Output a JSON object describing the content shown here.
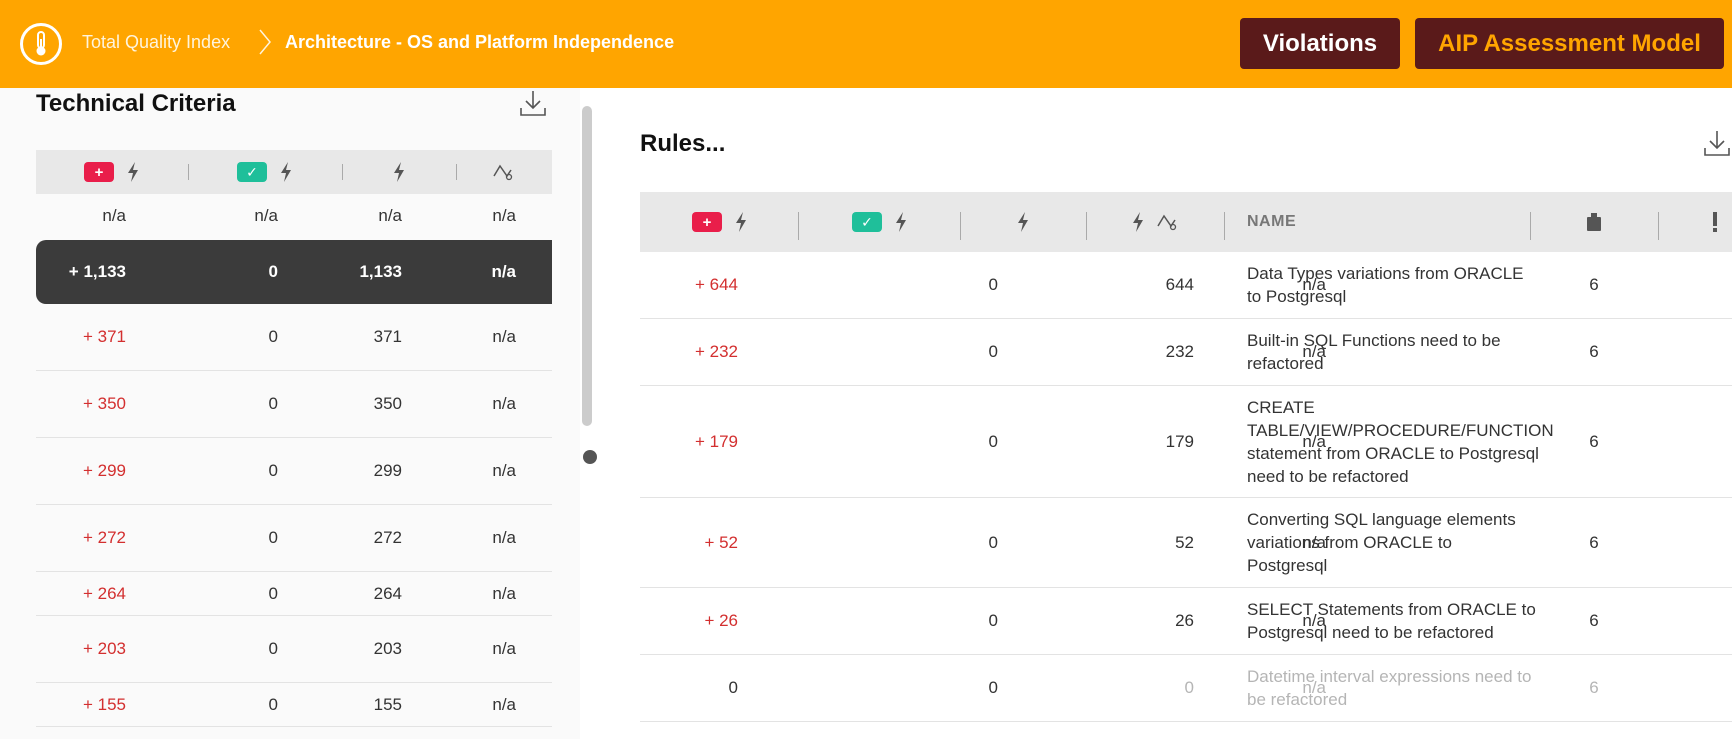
{
  "header": {
    "breadcrumb_root": "Total Quality Index",
    "breadcrumb_current": "Architecture - OS and Platform Independence",
    "violations_label": "Violations",
    "model_label": "AIP Assessment Model"
  },
  "technical_criteria": {
    "title": "Technical Criteria",
    "summary": [
      "n/a",
      "n/a",
      "n/a",
      "n/a"
    ],
    "rows": [
      {
        "added": "+ 1,133",
        "removed": "0",
        "total": "1,133",
        "trend": "n/a",
        "selected": true
      },
      {
        "added": "+ 371",
        "removed": "0",
        "total": "371",
        "trend": "n/a"
      },
      {
        "added": "+ 350",
        "removed": "0",
        "total": "350",
        "trend": "n/a"
      },
      {
        "added": "+ 299",
        "removed": "0",
        "total": "299",
        "trend": "n/a"
      },
      {
        "added": "+ 272",
        "removed": "0",
        "total": "272",
        "trend": "n/a"
      },
      {
        "added": "+ 264",
        "removed": "0",
        "total": "264",
        "trend": "n/a"
      },
      {
        "added": "+ 203",
        "removed": "0",
        "total": "203",
        "trend": "n/a"
      },
      {
        "added": "+ 155",
        "removed": "0",
        "total": "155",
        "trend": "n/a"
      }
    ]
  },
  "rules": {
    "title": "Rules...",
    "name_header": "NAME",
    "rows": [
      {
        "added": "+ 644",
        "removed": "0",
        "total": "644",
        "trend": "n/a",
        "name": "Data Types variations from ORACLE to Postgresql",
        "weight": "6"
      },
      {
        "added": "+ 232",
        "removed": "0",
        "total": "232",
        "trend": "n/a",
        "name": "Built-in SQL Functions need to be refactored",
        "weight": "6"
      },
      {
        "added": "+ 179",
        "removed": "0",
        "total": "179",
        "trend": "n/a",
        "name": "CREATE TABLE/VIEW/PROCEDURE/FUNCTION statement from ORACLE to Postgresql need to be refactored",
        "weight": "6"
      },
      {
        "added": "+ 52",
        "removed": "0",
        "total": "52",
        "trend": "n/a",
        "name": "Converting SQL language elements variations from ORACLE to Postgresql",
        "weight": "6"
      },
      {
        "added": "+ 26",
        "removed": "0",
        "total": "26",
        "trend": "n/a",
        "name": "SELECT Statements from ORACLE to Postgresql need to be refactored",
        "weight": "6"
      },
      {
        "added": "0",
        "removed": "0",
        "total": "0",
        "trend": "n/a",
        "name": "Datetime interval expressions need to be refactored",
        "weight": "6"
      }
    ]
  },
  "badges": {
    "added_symbol": "+",
    "removed_symbol": "✓"
  },
  "colors": {
    "header_bg": "#ffa500",
    "button_bg": "#5a1a1a",
    "added_red": "#d32f2f",
    "badge_plus": "#e91e4a",
    "badge_check": "#1fbf9a"
  }
}
